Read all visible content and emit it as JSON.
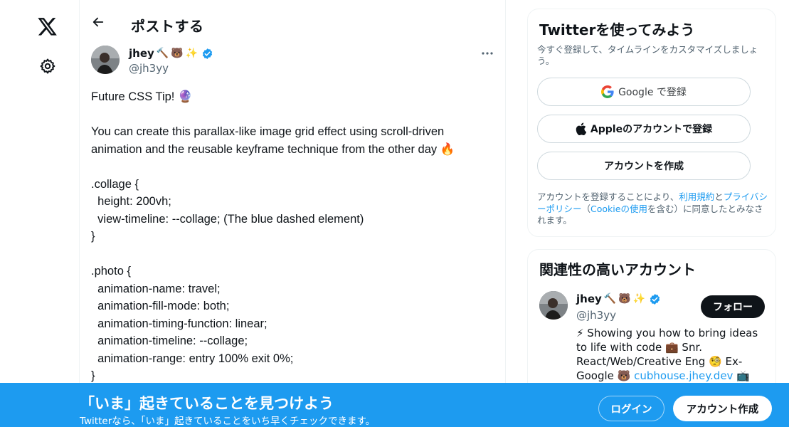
{
  "colors": {
    "accent": "#1d9bf0",
    "text": "#0f1419",
    "muted": "#536471",
    "border": "#eff3f4"
  },
  "nav": {
    "logo_icon": "x-logo-icon",
    "settings_icon": "gear-icon"
  },
  "header": {
    "back_icon": "arrow-left-icon",
    "title": "ポストする"
  },
  "tweet": {
    "author_name": "jhey",
    "author_emojis": [
      "🔨",
      "🐻",
      "✨"
    ],
    "author_handle": "@jh3yy",
    "more_icon": "more-horizontal-icon",
    "lines": [
      "Future CSS Tip! 🔮",
      "",
      "You can create this parallax-like image grid effect using scroll-driven",
      "animation and the reusable keyframe technique from the other day 🔥",
      "",
      ".collage {",
      "  height: 200vh;",
      "  view-timeline: --collage; (The blue dashed element)",
      "}",
      "",
      ".photo {",
      "  animation-name: travel;",
      "  animation-fill-mode: both;",
      "  animation-timing-function: linear;",
      "  animation-timeline: --collage;",
      "  animation-range: entry 100% exit 0%;",
      "}"
    ]
  },
  "signup": {
    "title": "Twitterを使ってみよう",
    "subtitle": "今すぐ登録して、タイムラインをカスタマイズしましょう。",
    "google_label": "Google で登録",
    "apple_label": "Appleのアカウントで登録",
    "create_label": "アカウントを作成",
    "legal_prefix": "アカウントを登録することにより、",
    "legal_terms": "利用規約",
    "legal_and": "と",
    "legal_privacy": "プライバシーポリシー",
    "legal_open": "（",
    "legal_cookie": "Cookieの使用",
    "legal_suffix": "を含む）に同意したとみなされます。"
  },
  "related": {
    "title": "関連性の高いアカウント",
    "name": "jhey",
    "handle": "@jh3yy",
    "follow_label": "フォロー",
    "bio_part1": "⚡ Showing you how to bring ideas to life with code 💼 Snr. React/Web/Creative Eng 🧐 Ex-Google 🐻 ",
    "bio_link": "cubhouse.jhey.dev",
    "bio_part2": " 📺"
  },
  "banner": {
    "title": "「いま」起きていることを見つけよう",
    "subtitle": "Twitterなら、「いま」起きていることをいち早くチェックできます。",
    "login_label": "ログイン",
    "signup_label": "アカウント作成"
  }
}
